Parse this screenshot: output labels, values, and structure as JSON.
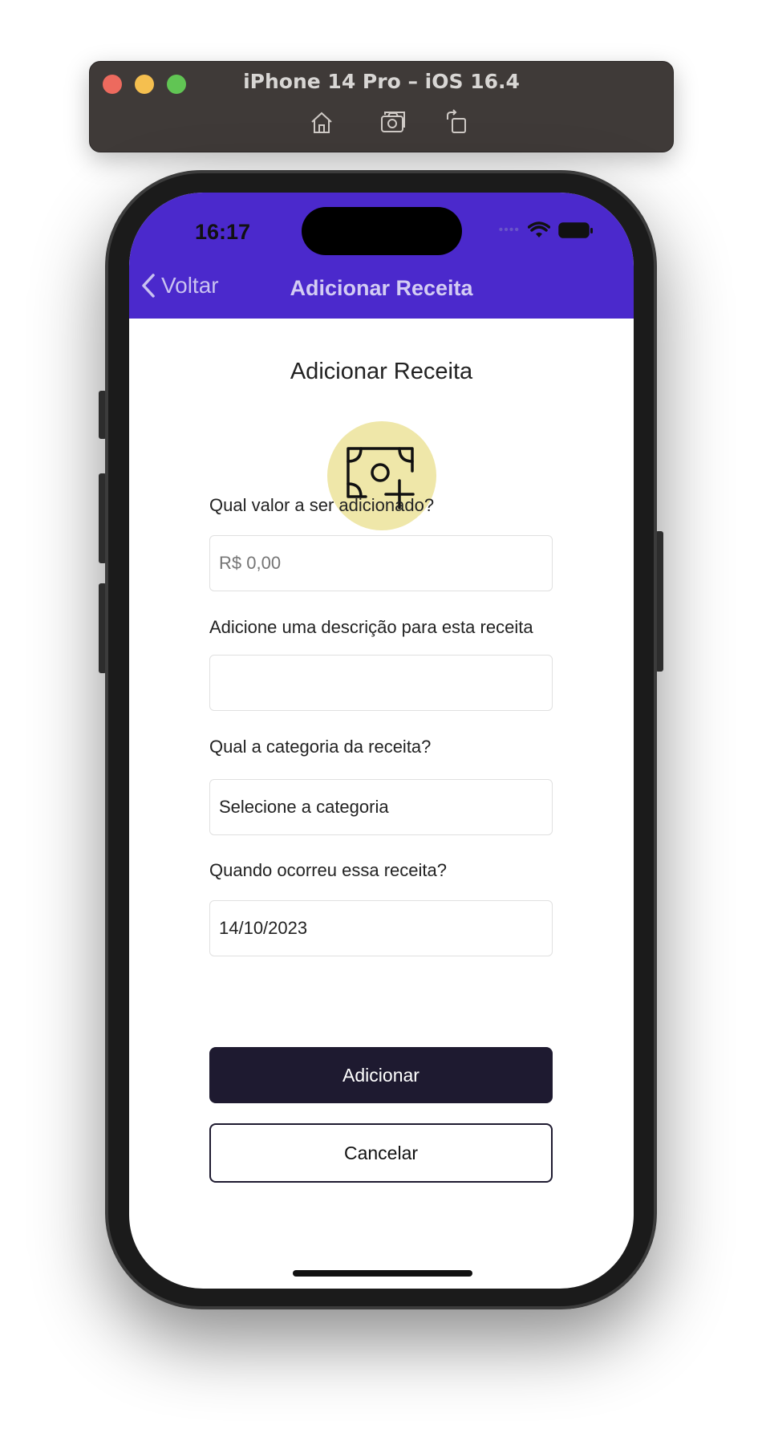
{
  "simulator": {
    "title": "iPhone 14 Pro – iOS 16.4"
  },
  "status_bar": {
    "time": "16:17",
    "signal_dots": "••••"
  },
  "nav": {
    "back_label": "Voltar",
    "title": "Adicionar Receita"
  },
  "form": {
    "heading": "Adicionar Receita",
    "icon": "money-add-icon",
    "amount": {
      "label": "Qual valor a ser adicionado?",
      "placeholder": "R$ 0,00",
      "value": ""
    },
    "description": {
      "label": "Adicione uma descrição para esta receita",
      "value": ""
    },
    "category": {
      "label": "Qual a categoria da receita?",
      "value": "Selecione a categoria"
    },
    "date": {
      "label": "Quando ocorreu essa receita?",
      "value": "14/10/2023"
    },
    "submit_label": "Adicionar",
    "cancel_label": "Cancelar"
  },
  "colors": {
    "header": "#4b29cc",
    "icon_circle": "#efe7a9",
    "primary_button": "#1e1a30"
  }
}
